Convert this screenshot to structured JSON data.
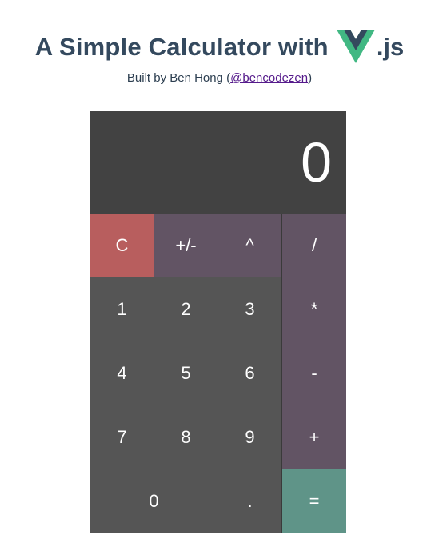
{
  "header": {
    "title": "A Simple Calculator with",
    "title_suffix": ".js",
    "byline_prefix": "Built by Ben Hong ",
    "byline_link": "@bencodezen",
    "byline_open": "(",
    "byline_close": ")",
    "logo_icon": "vue-logo-icon",
    "logo_colors": {
      "outer": "#41b883",
      "inner": "#34495e"
    }
  },
  "calculator": {
    "display_value": "0",
    "colors": {
      "display": "#424242",
      "number": "#555555",
      "operator": "#625464",
      "clear": "#b85e5e",
      "equals": "#5f9488"
    },
    "buttons": {
      "clear": "C",
      "sign": "+/-",
      "power": "^",
      "divide": "/",
      "one": "1",
      "two": "2",
      "three": "3",
      "multiply": "*",
      "four": "4",
      "five": "5",
      "six": "6",
      "subtract": "-",
      "seven": "7",
      "eight": "8",
      "nine": "9",
      "add": "+",
      "zero": "0",
      "decimal": ".",
      "equals": "="
    }
  }
}
